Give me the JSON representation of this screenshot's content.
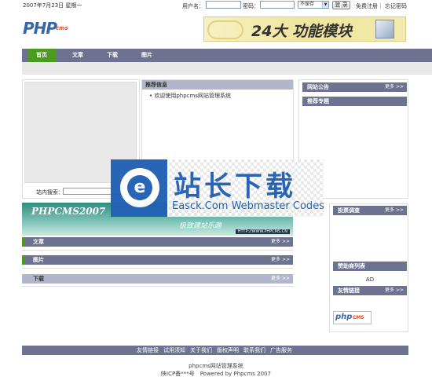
{
  "topbar": {
    "date": "2007年7月23日 星期一",
    "username_label": "用户名：",
    "password_label": "密码：",
    "cookie_option": "不保存",
    "login_button": "登 录",
    "register_link": "免费注册",
    "forgot_link": "忘记密码",
    "separator": "|"
  },
  "logo": {
    "main": "PHP",
    "sub": "cms"
  },
  "ad_banner": {
    "text": "24大 功能模块"
  },
  "nav": {
    "items": [
      {
        "label": "首页",
        "active": true
      },
      {
        "label": "文章",
        "active": false
      },
      {
        "label": "下载",
        "active": false
      },
      {
        "label": "图片",
        "active": false
      }
    ]
  },
  "left": {
    "search_label": "站内搜索："
  },
  "recommend": {
    "title": "推荐信息",
    "items": [
      "• 欢迎使用phpcms网站管理系统"
    ]
  },
  "right_top": [
    {
      "title": "网站公告",
      "more": "更多 >>"
    },
    {
      "title": "推荐专题",
      "more": ""
    }
  ],
  "watermark": {
    "logo_letter": "e",
    "cn": "站长下载",
    "en": "Easck.Com Webmaster Codes"
  },
  "banner": {
    "title": "PHPCMS2007",
    "slogan": "极致建站乐趣",
    "url": "HTTP://WWW.PHPCMS.CN"
  },
  "categories": [
    {
      "label": "文章",
      "more": "更多 >>"
    },
    {
      "label": "图片",
      "more": "更多 >>"
    },
    {
      "label": "下载",
      "more": "更多 >>"
    }
  ],
  "right_bottom": [
    {
      "title": "投票调查",
      "more": "更多 >>"
    },
    {
      "title": "赞助商列表",
      "more": ""
    },
    {
      "title": "友情链接",
      "more": "更多 >>"
    }
  ],
  "ad_text": "AD",
  "friend_logo": {
    "main": "php",
    "sub": "CMS"
  },
  "footer": {
    "links": [
      "友情链接",
      "试用须知",
      "关于我们",
      "版权声明",
      "联系我们",
      "广告服务"
    ],
    "line1": "phpcms网站管理系统",
    "line2": "陕ICP备***号　Powered by Phpcms 2007"
  },
  "colors": {
    "nav": "#6d7290",
    "active": "#4a9b1e",
    "watermark_blue": "#2361b4"
  }
}
